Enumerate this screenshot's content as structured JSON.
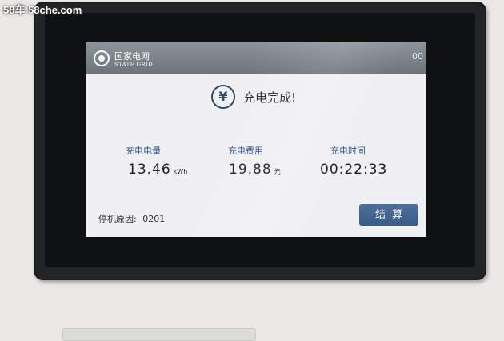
{
  "watermark": "58车  58che.com",
  "header": {
    "brand_cn": "国家电网",
    "brand_en": "STATE GRID",
    "time_fragment": "00"
  },
  "status": {
    "icon": "yuan-icon",
    "icon_glyph": "¥",
    "title": "充电完成!"
  },
  "metrics": [
    {
      "label": "充电电量",
      "value": "13.46",
      "unit": "kWh"
    },
    {
      "label": "充电费用",
      "value": "19.88",
      "unit": "元"
    },
    {
      "label": "充电时间",
      "value": "00:22:33",
      "unit": ""
    }
  ],
  "footer": {
    "stop_reason_label": "停机原因:",
    "stop_reason_code": "0201",
    "settle_button": "结算"
  },
  "colors": {
    "header_bg": "#7d838a",
    "label_blue": "#2d4e84",
    "button_bg": "#45658f",
    "screen_bg": "#f0f0f3"
  }
}
